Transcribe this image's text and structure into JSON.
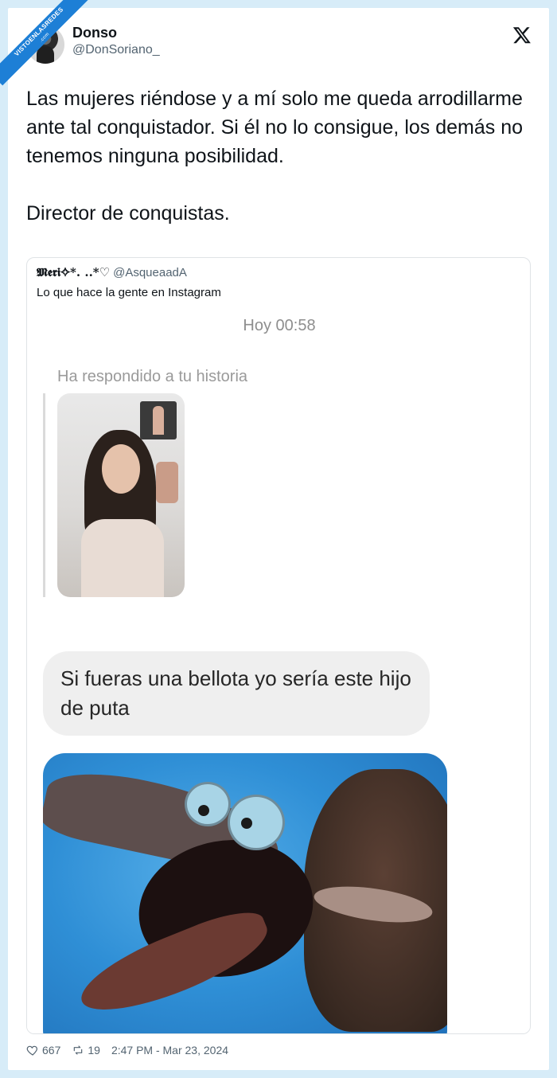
{
  "watermark": {
    "text": "VISTOENLASREDES",
    "sub": ".com"
  },
  "author": {
    "name": "Donso",
    "handle": "@DonSoriano_"
  },
  "tweet": {
    "paragraph1": "Las mujeres riéndose y a mí solo me queda arrodillarme ante tal conquistador. Si él no lo consigue, los demás no tenemos ninguna posibilidad.",
    "paragraph2": "Director de conquistas."
  },
  "quote": {
    "name": "𝕸𝖊𝖗𝖎✧*. ..*♡",
    "handle": "@AsqueaadA",
    "text": "Lo que hace la gente en Instagram",
    "chat": {
      "timestamp": "Hoy 00:58",
      "replied_label": "Ha respondido a tu historia",
      "message": "Si fueras una bellota yo sería este hijo de puta"
    }
  },
  "meta": {
    "likes": "667",
    "retweets": "19",
    "datetime": "2:47 PM - Mar 23, 2024"
  },
  "icons": {
    "logo": "x-logo-icon",
    "like": "heart-icon",
    "retweet": "retweet-icon"
  },
  "colors": {
    "background": "#d7ecf8",
    "ribbon": "#1d7fd6",
    "text_primary": "#0f1419",
    "text_secondary": "#536471",
    "bubble": "#efefef"
  }
}
